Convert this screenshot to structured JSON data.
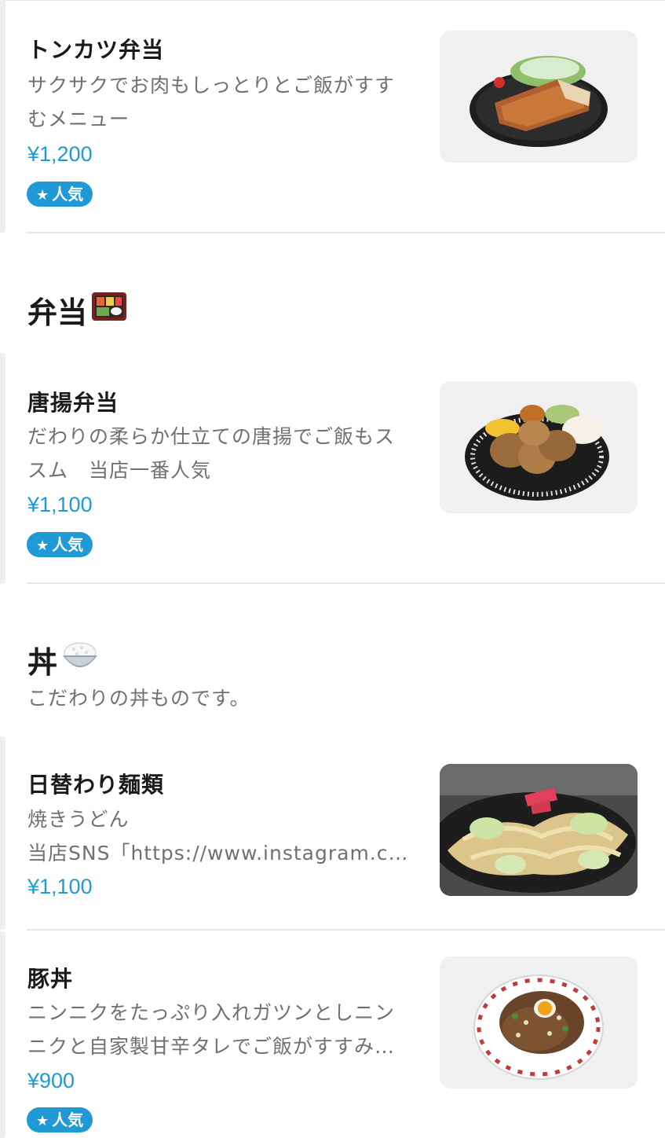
{
  "badge_label": "人気",
  "accent_color": "#1f9ad6",
  "sections": [
    {
      "title": "",
      "items": [
        {
          "name": "トンカツ弁当",
          "desc_lines": [
            "サクサクでお肉もしっとりとご飯がすす",
            "むメニュー"
          ],
          "price": "¥1,200",
          "popular": true,
          "image_icon": "tonkatsu-photo"
        }
      ]
    },
    {
      "title": "弁当",
      "title_icon": "bento-box-icon",
      "items": [
        {
          "name": "唐揚弁当",
          "desc_lines": [
            "だわりの柔らか仕立ての唐揚でご飯もス",
            "スム　当店一番人気"
          ],
          "price": "¥1,100",
          "popular": true,
          "image_icon": "karaage-photo"
        }
      ]
    },
    {
      "title": "丼",
      "title_icon": "rice-bowl-icon",
      "description": "こだわりの丼ものです。",
      "items": [
        {
          "name": "日替わり麺類",
          "desc_lines": [
            "焼きうどん",
            "当店SNS「https://www.instagram.co…"
          ],
          "price": "¥1,100",
          "popular": false,
          "image_icon": "yakiudon-photo"
        },
        {
          "name": "豚丼",
          "desc_lines": [
            "ニンニクをたっぷり入れガツンとしニン",
            "ニクと自家製甘辛タレでご飯がすすみ…"
          ],
          "price": "¥900",
          "popular": true,
          "image_icon": "butadon-photo"
        }
      ]
    }
  ]
}
